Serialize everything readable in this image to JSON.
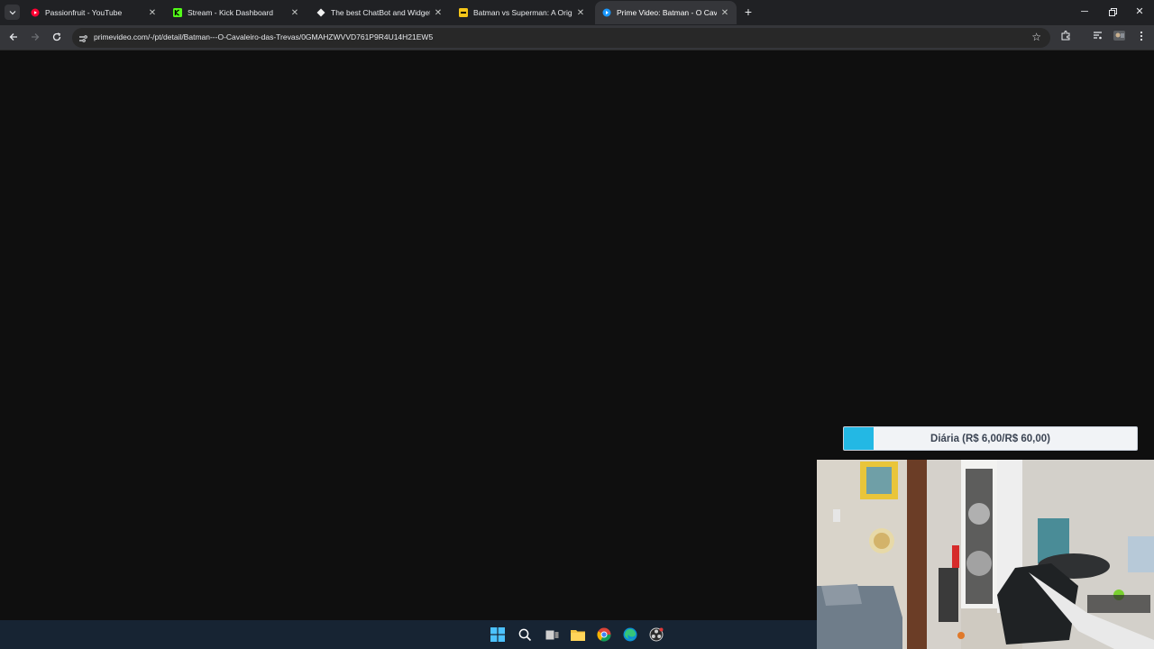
{
  "browser": {
    "tabs": [
      {
        "title": "Passionfruit - YouTube",
        "icon": "youtube-icon",
        "active": false
      },
      {
        "title": "Stream - Kick Dashboard",
        "icon": "kick-icon",
        "active": false
      },
      {
        "title": "The best ChatBot and Widgets",
        "icon": "diamond-icon",
        "active": false
      },
      {
        "title": "Batman vs Superman: A Origem",
        "icon": "imdb-icon",
        "active": false
      },
      {
        "title": "Prime Video: Batman - O Cavaleiro das Trevas",
        "icon": "prime-video-icon",
        "active": true
      }
    ],
    "url": "primevideo.com/-/pt/detail/Batman---O-Cavaleiro-das-Trevas/0GMAHZWVVD761P9R4U14H21EW5"
  },
  "overlay": {
    "goal_label": "Diária (R$ 6,00/R$ 60,00)",
    "goal_current": 6,
    "goal_target": 60,
    "goal_fraction": 0.1,
    "accent": "#23b8e4"
  },
  "taskbar": {
    "items": [
      "windows-start-icon",
      "search-icon",
      "task-view-icon",
      "file-explorer-icon",
      "chrome-icon",
      "edge-icon",
      "obs-icon"
    ]
  }
}
